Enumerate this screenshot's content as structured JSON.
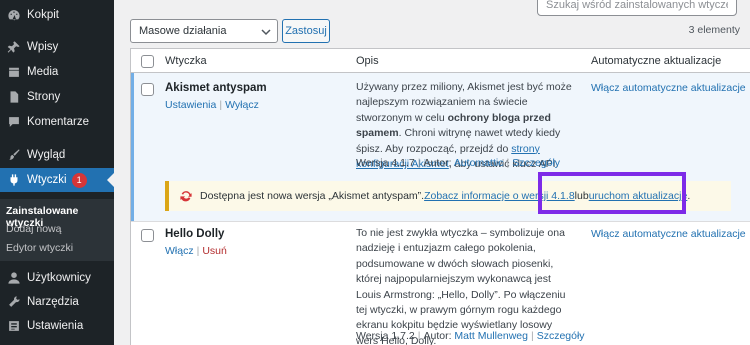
{
  "sidebar": {
    "items": [
      {
        "label": "Kokpit",
        "icon": "dashboard-icon"
      },
      {
        "label": "Wpisy",
        "icon": "pin-icon"
      },
      {
        "label": "Media",
        "icon": "media-icon"
      },
      {
        "label": "Strony",
        "icon": "page-icon"
      },
      {
        "label": "Komentarze",
        "icon": "comment-icon"
      },
      {
        "label": "Wygląd",
        "icon": "brush-icon"
      },
      {
        "label": "Wtyczki",
        "icon": "plugin-icon",
        "badge": "1"
      },
      {
        "label": "Użytkownicy",
        "icon": "users-icon"
      },
      {
        "label": "Narzędzia",
        "icon": "tools-icon"
      },
      {
        "label": "Ustawienia",
        "icon": "settings-icon"
      }
    ],
    "submenu": [
      {
        "label": "Zainstalowane wtyczki"
      },
      {
        "label": "Dodaj nową"
      },
      {
        "label": "Edytor wtyczki"
      }
    ]
  },
  "search": {
    "placeholder": "Szukaj wśród zainstalowanych wtyczek..."
  },
  "bulk": {
    "selected": "Masowe działania",
    "apply_label": "Zastosuj"
  },
  "items_count": "3 elementy",
  "table": {
    "headers": {
      "plugin": "Wtyczka",
      "description": "Opis",
      "auto_updates": "Automatyczne aktualizacje"
    },
    "rows": [
      {
        "name": "Akismet antyspam",
        "actions": {
          "a1": "Ustawienia",
          "a2": "Wyłącz"
        },
        "desc": {
          "part1": "Używany przez miliony, Akismet jest być może najlepszym rozwiązaniem na świecie stworzonym w celu ",
          "strong": "ochrony bloga przed spamem",
          "part2": ". Chroni witrynę nawet wtedy kiedy śpisz. Aby rozpocząć, przejdź do ",
          "link": "strony konfiguracji Akismet",
          "part3": ", aby ustawić klucz API."
        },
        "meta": {
          "version": "Wersja 4.1.7",
          "author_prefix": "Autor:",
          "author": "Automattic",
          "details": "Szczegóły"
        },
        "auto_link": "Włącz automatyczne aktualizacje",
        "update": {
          "text": "Dostępna jest nowa wersja „Akismet antyspam”. ",
          "link1": "Zobacz informacje o wersji 4.1.8",
          "mid": " lub ",
          "link2": "uruchom aktualizacje",
          "end": "."
        }
      },
      {
        "name": "Hello Dolly",
        "actions": {
          "a1": "Włącz",
          "a2": "Usuń"
        },
        "desc": {
          "text": "To nie jest zwykła wtyczka – symbolizuje ona nadzieję i entuzjazm całego pokolenia, podsumowane w dwóch słowach piosenki, której najpopularniejszym wykonawcą jest Louis Armstrong: „Hello, Dolly”. Po włączeniu tej wtyczki, w prawym górnym rogu każdego ekranu kokpitu będzie wyświetlany losowy wers Hello, Dolly."
        },
        "meta": {
          "version": "Wersja 1.7.2",
          "author_prefix": "Autor:",
          "author": "Matt Mullenweg",
          "details": "Szczegóły"
        },
        "auto_link": "Włącz automatyczne aktualizacje"
      }
    ]
  },
  "colors": {
    "accent": "#2271b1",
    "sidebar_bg": "#1d2327",
    "highlight": "#7d2ae8",
    "update_bg": "#fcf9e8",
    "badge": "#d63638"
  }
}
